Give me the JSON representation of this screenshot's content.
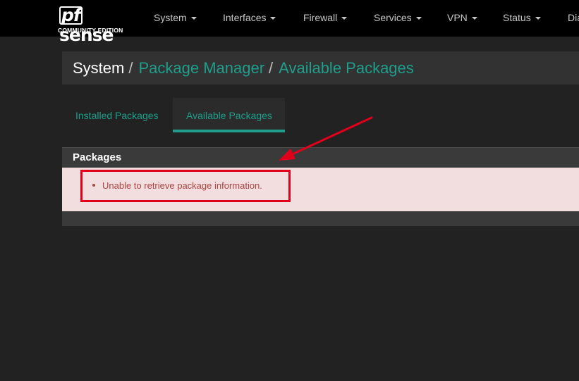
{
  "brand": {
    "logo_pf": "pf",
    "logo_sense": "sense",
    "edition": "COMMUNITY EDITION"
  },
  "nav": {
    "items": [
      {
        "label": "System"
      },
      {
        "label": "Interfaces"
      },
      {
        "label": "Firewall"
      },
      {
        "label": "Services"
      },
      {
        "label": "VPN"
      },
      {
        "label": "Status"
      },
      {
        "label": "Dia"
      }
    ]
  },
  "breadcrumb": {
    "root": "System",
    "separator": "/",
    "items": [
      "Package Manager",
      "Available Packages"
    ]
  },
  "tabs": [
    {
      "label": "Installed Packages",
      "active": false
    },
    {
      "label": "Available Packages",
      "active": true
    }
  ],
  "panel": {
    "title": "Packages",
    "error": "Unable to retrieve package information."
  },
  "colors": {
    "accent": "#1e9e8b",
    "annotation": "#e0001a",
    "error_text": "#a94442",
    "error_bg": "#f2dede"
  },
  "icons": [
    "caret-down-icon",
    "bullet-icon",
    "annotation-arrow-icon"
  ]
}
